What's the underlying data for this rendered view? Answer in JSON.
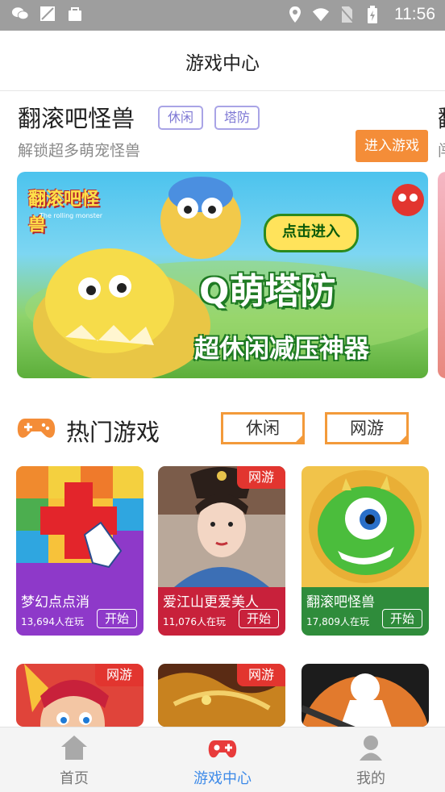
{
  "status": {
    "time": "11:56"
  },
  "header": {
    "title": "游戏中心"
  },
  "featured": {
    "title": "翻滚吧怪兽",
    "tags": [
      "休闲",
      "塔防"
    ],
    "subtitle": "解锁超多萌宠怪兽",
    "enter_label": "进入游戏",
    "next_title_peek": "翻",
    "next_sub_peek": "闯",
    "banner": {
      "logo_text": "翻滚吧怪兽",
      "logo_sub": "The rolling monster",
      "cta": "点击进入",
      "headline": "Q萌塔防",
      "tagline": "超休闲减压神器"
    }
  },
  "hot": {
    "title": "热门游戏",
    "filters": [
      "休闲",
      "网游"
    ]
  },
  "games": [
    {
      "name": "梦幻点点消",
      "players": "13,694人在玩",
      "start": "开始",
      "badge": "",
      "color": "#8e39c9"
    },
    {
      "name": "爱江山更爱美人",
      "players": "11,076人在玩",
      "start": "开始",
      "badge": "网游",
      "color": "#c8213b"
    },
    {
      "name": "翻滚吧怪兽",
      "players": "17,809人在玩",
      "start": "开始",
      "badge": "",
      "color": "#2f8c3b"
    },
    {
      "name": "",
      "players": "",
      "start": "",
      "badge": "网游",
      "color": "#c8213b"
    },
    {
      "name": "",
      "players": "",
      "start": "",
      "badge": "网游",
      "color": "#a4711f"
    },
    {
      "name": "",
      "players": "",
      "start": "",
      "badge": "",
      "color": "#222222"
    }
  ],
  "tabs": [
    {
      "label": "首页",
      "icon": "home-icon",
      "active": false
    },
    {
      "label": "游戏中心",
      "icon": "gamepad-icon",
      "active": true
    },
    {
      "label": "我的",
      "icon": "profile-icon",
      "active": false
    }
  ],
  "colors": {
    "accent": "#f48d38",
    "active_tab": "#3d8ae8",
    "inactive_tab": "#888888",
    "tag_border": "#a9a4e6"
  }
}
